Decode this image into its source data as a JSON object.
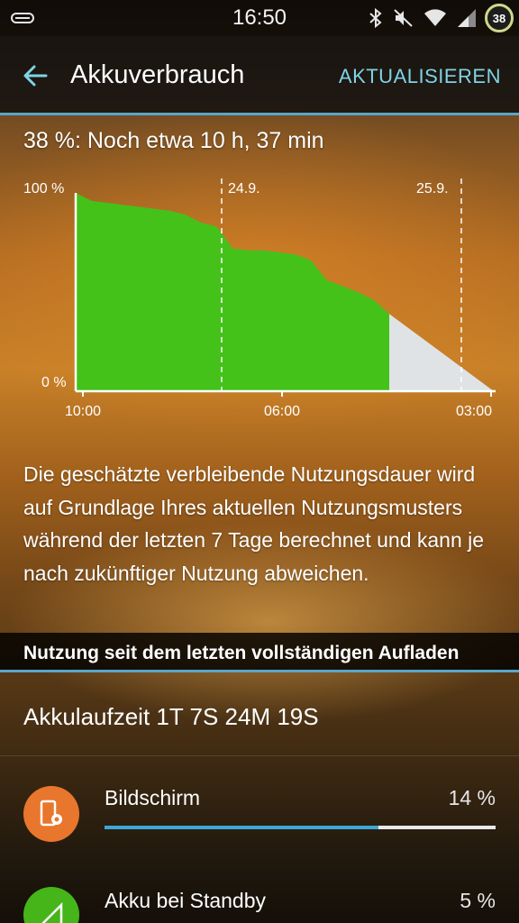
{
  "status_bar": {
    "time": "16:50",
    "battery_level": "38",
    "icons": [
      "notification-icon",
      "bluetooth-icon",
      "mute-icon",
      "wifi-icon",
      "signal-icon"
    ]
  },
  "app_bar": {
    "title": "Akkuverbrauch",
    "action": "AKTUALISIEREN"
  },
  "remaining": "38 %: Noch etwa 10 h, 37 min",
  "chart_data": {
    "type": "area",
    "y_ticks": [
      "100 %",
      "0 %"
    ],
    "x_ticks": [
      "10:00",
      "06:00",
      "03:00"
    ],
    "date_markers": [
      "24.9.",
      "25.9."
    ],
    "ylim": [
      0,
      100
    ],
    "series": [
      {
        "values_pct": [
          100,
          96,
          95,
          94,
          93,
          92,
          91,
          89,
          85,
          83,
          72,
          71,
          71,
          70,
          69,
          66,
          56,
          53,
          50,
          46,
          39
        ],
        "color": "#44c219"
      },
      {
        "values_pct": [
          39,
          0
        ],
        "color": "#dfe3e6"
      }
    ]
  },
  "info_text": "Die geschätzte verbleibende Nutzungsdauer wird auf Grundlage Ihres aktuellen Nutzungsmusters während der letzten 7 Tage berechnet und kann je nach zukünftiger Nutzung abweichen.",
  "section_header": "Nutzung seit dem letzten vollständigen Aufladen",
  "uptime": "Akkulaufzeit 1T 7S 24M 19S",
  "usage_items": [
    {
      "label": "Bildschirm",
      "percent": "14 %",
      "bar_fraction": 0.7,
      "icon": "screen-settings-icon",
      "icon_color": "#e8762c"
    },
    {
      "label": "Akku bei Standby",
      "percent": "5 %",
      "bar_fraction": 0.25,
      "icon": "standby-signal-icon",
      "icon_color": "#45b51a"
    }
  ]
}
